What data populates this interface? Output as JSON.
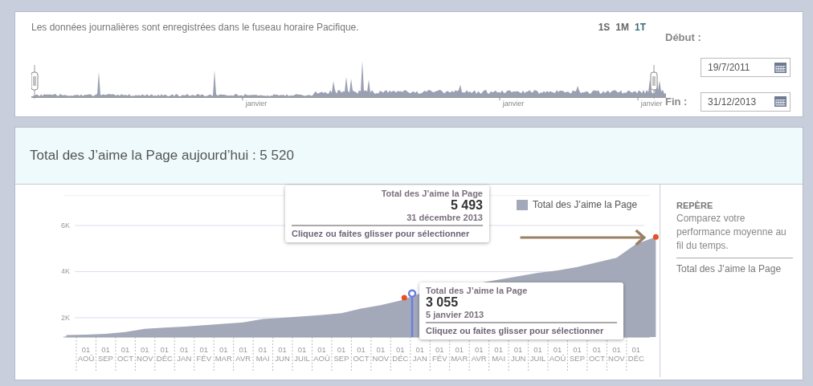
{
  "note": "Les données journalières sont enregistrées dans le fuseau horaire Pacifique.",
  "range_buttons": [
    {
      "label": "1S",
      "selected": false
    },
    {
      "label": "1M",
      "selected": false
    },
    {
      "label": "1T",
      "selected": true
    }
  ],
  "overview": {
    "axis_labels": [
      "janvier",
      "janvier",
      "janvier"
    ]
  },
  "date_range": {
    "start_label": "Début :",
    "start_value": "19/7/2011",
    "end_label": "Fin :",
    "end_value": "31/12/2013"
  },
  "summary": "Total des J’aime la Page aujourd’hui : 5 520",
  "chart_data": {
    "type": "area",
    "series": [
      {
        "name": "Total des J’aime la Page",
        "color": "#a3a9b8",
        "values": [
          1250,
          1270,
          1300,
          1380,
          1520,
          1570,
          1620,
          1680,
          1740,
          1800,
          1950,
          2000,
          2060,
          2120,
          2200,
          2400,
          2550,
          2750,
          3050,
          null,
          null,
          3500,
          3650,
          3800,
          3950,
          4050,
          4200,
          4400,
          4600,
          5200,
          5500
        ]
      }
    ],
    "categories": [
      null,
      "01 AOÛ",
      "01 SEP",
      "01 OCT",
      "01 NOV",
      "01 DÉC",
      "01 JAN",
      "01 FÉV",
      "01 MAR",
      "01 AVR",
      "01 MAI",
      "01 JUN",
      "01 JUIL",
      "01 AOÛ",
      "01 SEP",
      "01 OCT",
      "01 NOV",
      "01 DÉC",
      "01 JAN",
      "01 FÉV",
      "01 MAR",
      "01 AVR",
      "01 MAI",
      "01 JUN",
      "01 JUIL",
      "01 AOÛ",
      "01 SEP",
      "01 OCT",
      "01 NOV",
      "01 DÉC",
      null
    ],
    "grid": true,
    "ylim": [
      1165,
      7300
    ],
    "yticks": [
      {
        "value": 2000,
        "label": "2K"
      },
      {
        "value": 4000,
        "label": "4K"
      },
      {
        "value": 6000,
        "label": "6K"
      }
    ]
  },
  "markers": [
    {
      "kind": "dot"
    },
    {
      "kind": "hover"
    },
    {
      "kind": "dot"
    },
    {
      "kind": "arrow"
    }
  ],
  "tooltips": [
    {
      "kind": "pinned",
      "title": "Total des J’aime la Page",
      "value": "5 493",
      "date": "31 décembre 2013",
      "hint": "Cliquez ou faites glisser pour sélectionner"
    },
    {
      "kind": "hover",
      "title": "Total des J’aime la Page",
      "value": "3 055",
      "date": "5 janvier 2013",
      "hint": "Cliquez ou faites glisser pour sélectionner"
    }
  ],
  "benchmark": {
    "title": "REPÈRE",
    "description": "Comparez votre performance moyenne au fil du temps.",
    "item": "Total des J’aime la Page"
  }
}
